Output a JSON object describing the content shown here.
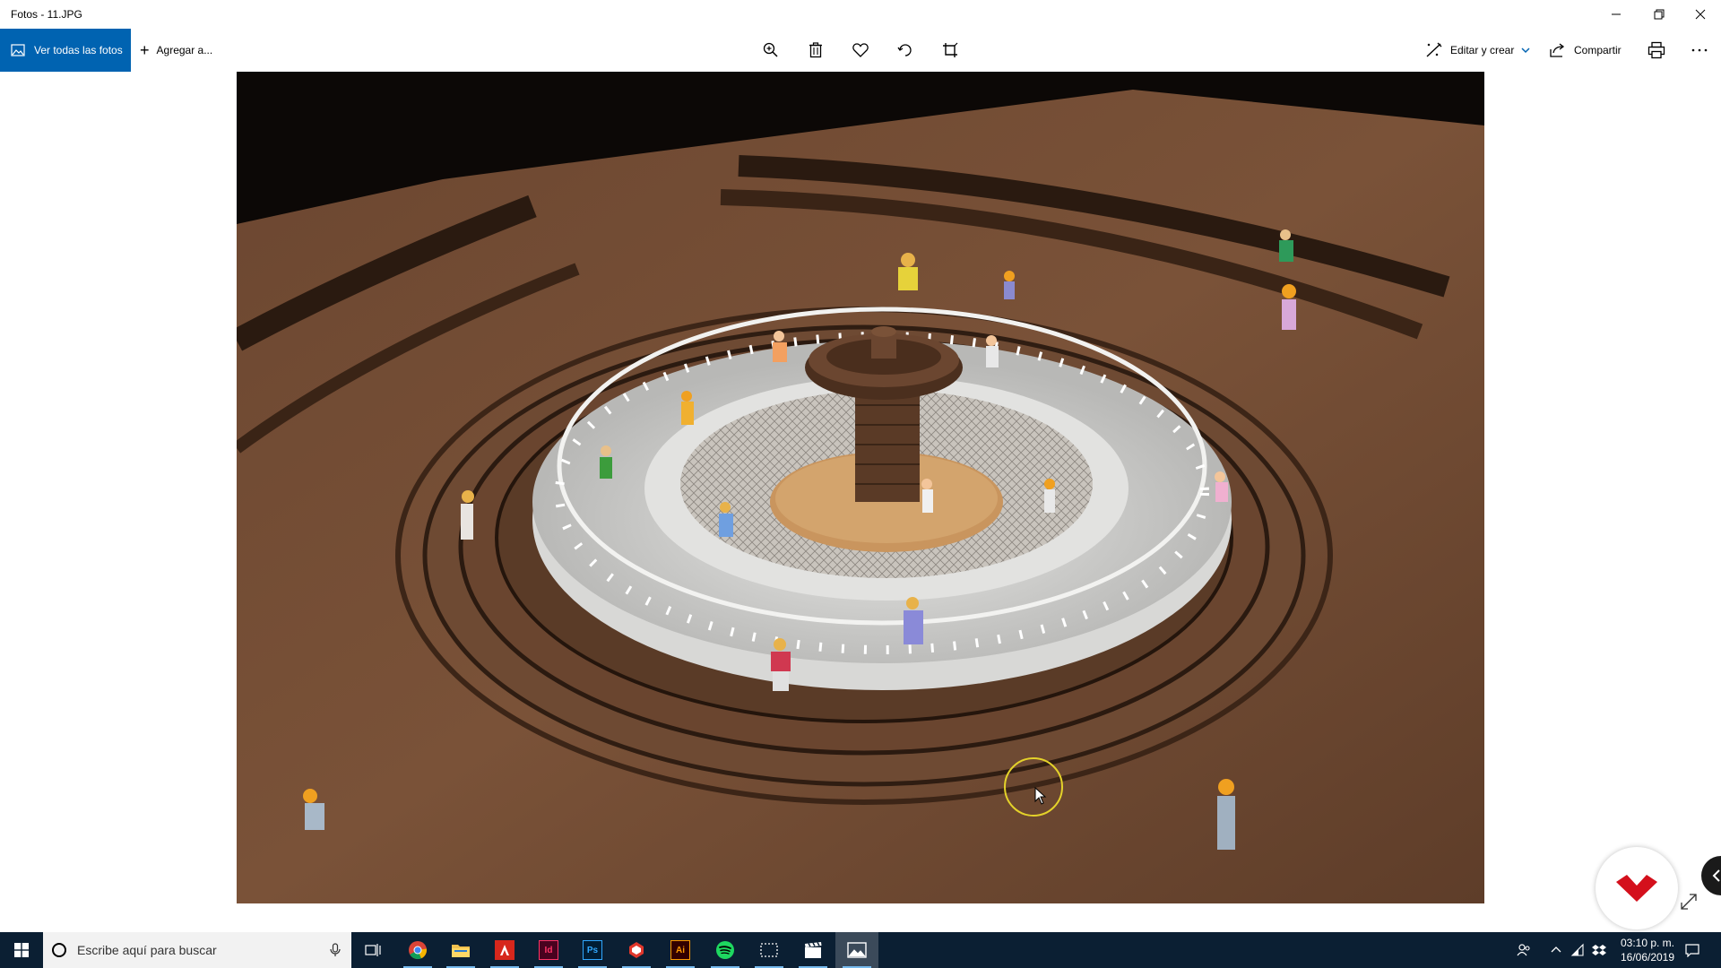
{
  "window": {
    "title": "Fotos - 11.JPG"
  },
  "toolbar": {
    "view_all_label": "Ver todas las fotos",
    "add_to_label": "Agregar a...",
    "edit_create_label": "Editar y crear",
    "share_label": "Compartir"
  },
  "taskbar": {
    "search_placeholder": "Escribe aquí para buscar",
    "apps": [
      "chrome",
      "file-explorer",
      "acrobat",
      "indesign",
      "photoshop",
      "sketchup",
      "illustrator",
      "spotify",
      "snipping-tool",
      "video-editor",
      "photos"
    ],
    "app_letters": {
      "indesign": "Id",
      "photoshop": "Ps",
      "illustrator": "Ai"
    },
    "clock_time": "03:10 p. m.",
    "clock_date": "16/06/2019"
  },
  "colors": {
    "accent": "#0063b1",
    "taskbar": "#0b1f33"
  }
}
